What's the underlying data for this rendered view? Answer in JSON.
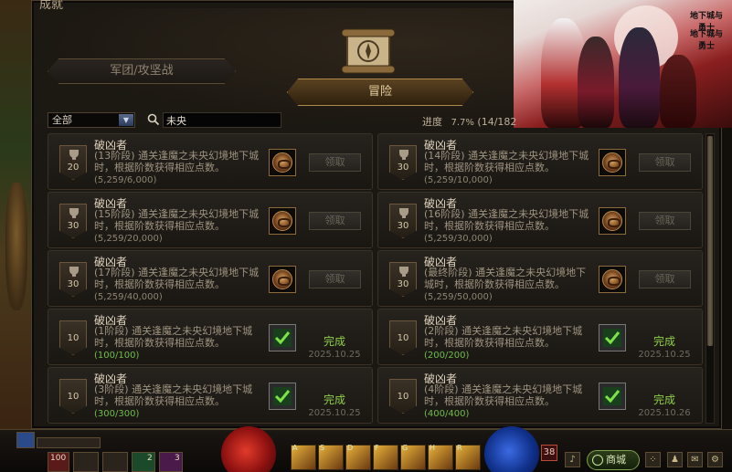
{
  "window": {
    "title": "成就"
  },
  "tabs": {
    "legion": "军团/攻坚战",
    "adventure": "冒险"
  },
  "filter": {
    "category_selected": "全部",
    "search_value": "未央"
  },
  "progress": {
    "label": "进度",
    "percent": "7.7%",
    "count": "(14/182"
  },
  "achievements": [
    {
      "title": "破凶者",
      "desc": "(13阶段) 通关逢魔之未央幻境地下城时，根据阶数获得相应点数。",
      "count": "(5,259/6,000)",
      "points": "20",
      "state": "locked",
      "claim": "领取"
    },
    {
      "title": "破凶者",
      "desc": "(14阶段) 通关逢魔之未央幻境地下城时，根据阶数获得相应点数。",
      "count": "(5,259/10,000)",
      "points": "30",
      "state": "locked",
      "claim": "领取"
    },
    {
      "title": "破凶者",
      "desc": "(15阶段) 通关逢魔之未央幻境地下城时，根据阶数获得相应点数。",
      "count": "(5,259/20,000)",
      "points": "30",
      "state": "locked",
      "claim": "领取"
    },
    {
      "title": "破凶者",
      "desc": "(16阶段) 通关逢魔之未央幻境地下城时，根据阶数获得相应点数。",
      "count": "(5,259/30,000)",
      "points": "30",
      "state": "locked",
      "claim": "领取"
    },
    {
      "title": "破凶者",
      "desc": "(17阶段) 通关逢魔之未央幻境地下城时，根据阶数获得相应点数。",
      "count": "(5,259/40,000)",
      "points": "30",
      "state": "locked",
      "claim": "领取"
    },
    {
      "title": "破凶者",
      "desc": "(最终阶段) 通关逢魔之未央幻境地下城时，根据阶数获得相应点数。",
      "count": "(5,259/50,000)",
      "points": "30",
      "state": "locked",
      "claim": "领取"
    },
    {
      "title": "破凶者",
      "desc": "(1阶段) 通关逢魔之未央幻境地下城时，根据阶数获得相应点数。",
      "count": "(100/100)",
      "points": "10",
      "state": "done",
      "done": "完成",
      "date": "2025.10.25"
    },
    {
      "title": "破凶者",
      "desc": "(2阶段) 通关逢魔之未央幻境地下城时，根据阶数获得相应点数。",
      "count": "(200/200)",
      "points": "10",
      "state": "done",
      "done": "完成",
      "date": "2025.10.25"
    },
    {
      "title": "破凶者",
      "desc": "(3阶段) 通关逢魔之未央幻境地下城时，根据阶数获得相应点数。",
      "count": "(300/300)",
      "points": "10",
      "state": "done",
      "done": "完成",
      "date": "2025.10.25"
    },
    {
      "title": "破凶者",
      "desc": "(4阶段) 通关逢魔之未央幻境地下城时，根据阶数获得相应点数。",
      "count": "(400/400)",
      "points": "10",
      "state": "done",
      "done": "完成",
      "date": "2025.10.26"
    }
  ],
  "banner": {
    "logo_top": "地下城与勇士",
    "logo_bottom": "地下城与勇士"
  },
  "hud": {
    "hp_value": "100",
    "level": "38",
    "shop_label": "商城",
    "skill_keys": [
      "A",
      "S",
      "D",
      "F",
      "G",
      "H",
      "R"
    ],
    "inventory_counts": [
      "2",
      "3"
    ]
  },
  "colors": {
    "accent_gold": "#b08a4a",
    "done_green": "#8fd04a",
    "panel_bg": "#1b1814"
  }
}
